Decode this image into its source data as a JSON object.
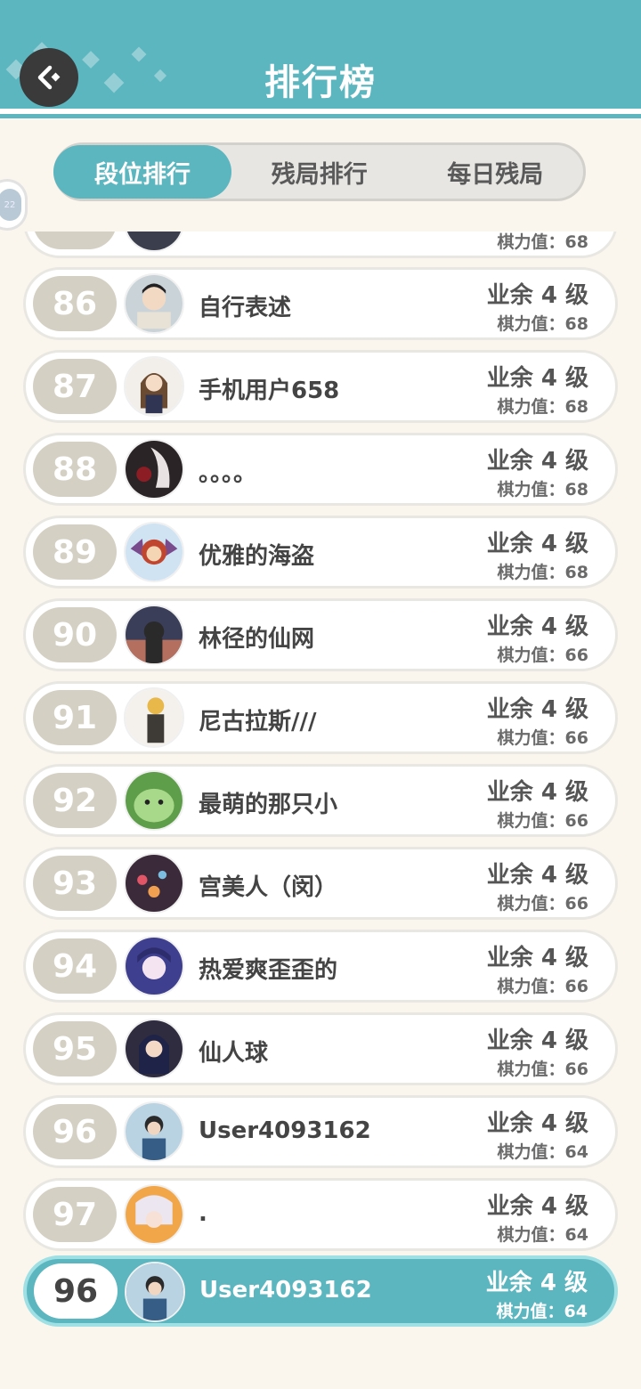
{
  "header": {
    "title": "排行榜",
    "back_icon": "back-arrow-icon"
  },
  "tabs": [
    {
      "label": "段位排行",
      "active": true
    },
    {
      "label": "残局排行",
      "active": false
    },
    {
      "label": "每日残局",
      "active": false
    }
  ],
  "side_bubble": {
    "text": "22"
  },
  "partial_row": {
    "power": "棋力值：68"
  },
  "rows": [
    {
      "rank": "86",
      "name": "自行表述",
      "level": "业余 4 级",
      "power": "棋力值：68"
    },
    {
      "rank": "87",
      "name": "手机用户658",
      "level": "业余 4 级",
      "power": "棋力值：68"
    },
    {
      "rank": "88",
      "name": "。。。。",
      "level": "业余 4 级",
      "power": "棋力值：68"
    },
    {
      "rank": "89",
      "name": "优雅的海盗",
      "level": "业余 4 级",
      "power": "棋力值：68"
    },
    {
      "rank": "90",
      "name": "林径的仙网",
      "level": "业余 4 级",
      "power": "棋力值：66"
    },
    {
      "rank": "91",
      "name": "尼古拉斯///",
      "level": "业余 4 级",
      "power": "棋力值：66"
    },
    {
      "rank": "92",
      "name": "最萌的那只小",
      "level": "业余 4 级",
      "power": "棋力值：66"
    },
    {
      "rank": "93",
      "name": "宫美人（闵）",
      "level": "业余 4 级",
      "power": "棋力值：66"
    },
    {
      "rank": "94",
      "name": "热爱爽歪歪的",
      "level": "业余 4 级",
      "power": "棋力值：66"
    },
    {
      "rank": "95",
      "name": "仙人球",
      "level": "业余 4 级",
      "power": "棋力值：66"
    },
    {
      "rank": "96",
      "name": "User4093162",
      "level": "业余 4 级",
      "power": "棋力值：64"
    },
    {
      "rank": "97",
      "name": ".",
      "level": "业余 4 级",
      "power": "棋力值：64"
    }
  ],
  "me": {
    "rank": "96",
    "name": "User4093162",
    "level": "业余 4 级",
    "power": "棋力值：64"
  },
  "colors": {
    "accent": "#5cb6bf",
    "rank_pill": "#d4d0c4",
    "background": "#faf6ee"
  }
}
